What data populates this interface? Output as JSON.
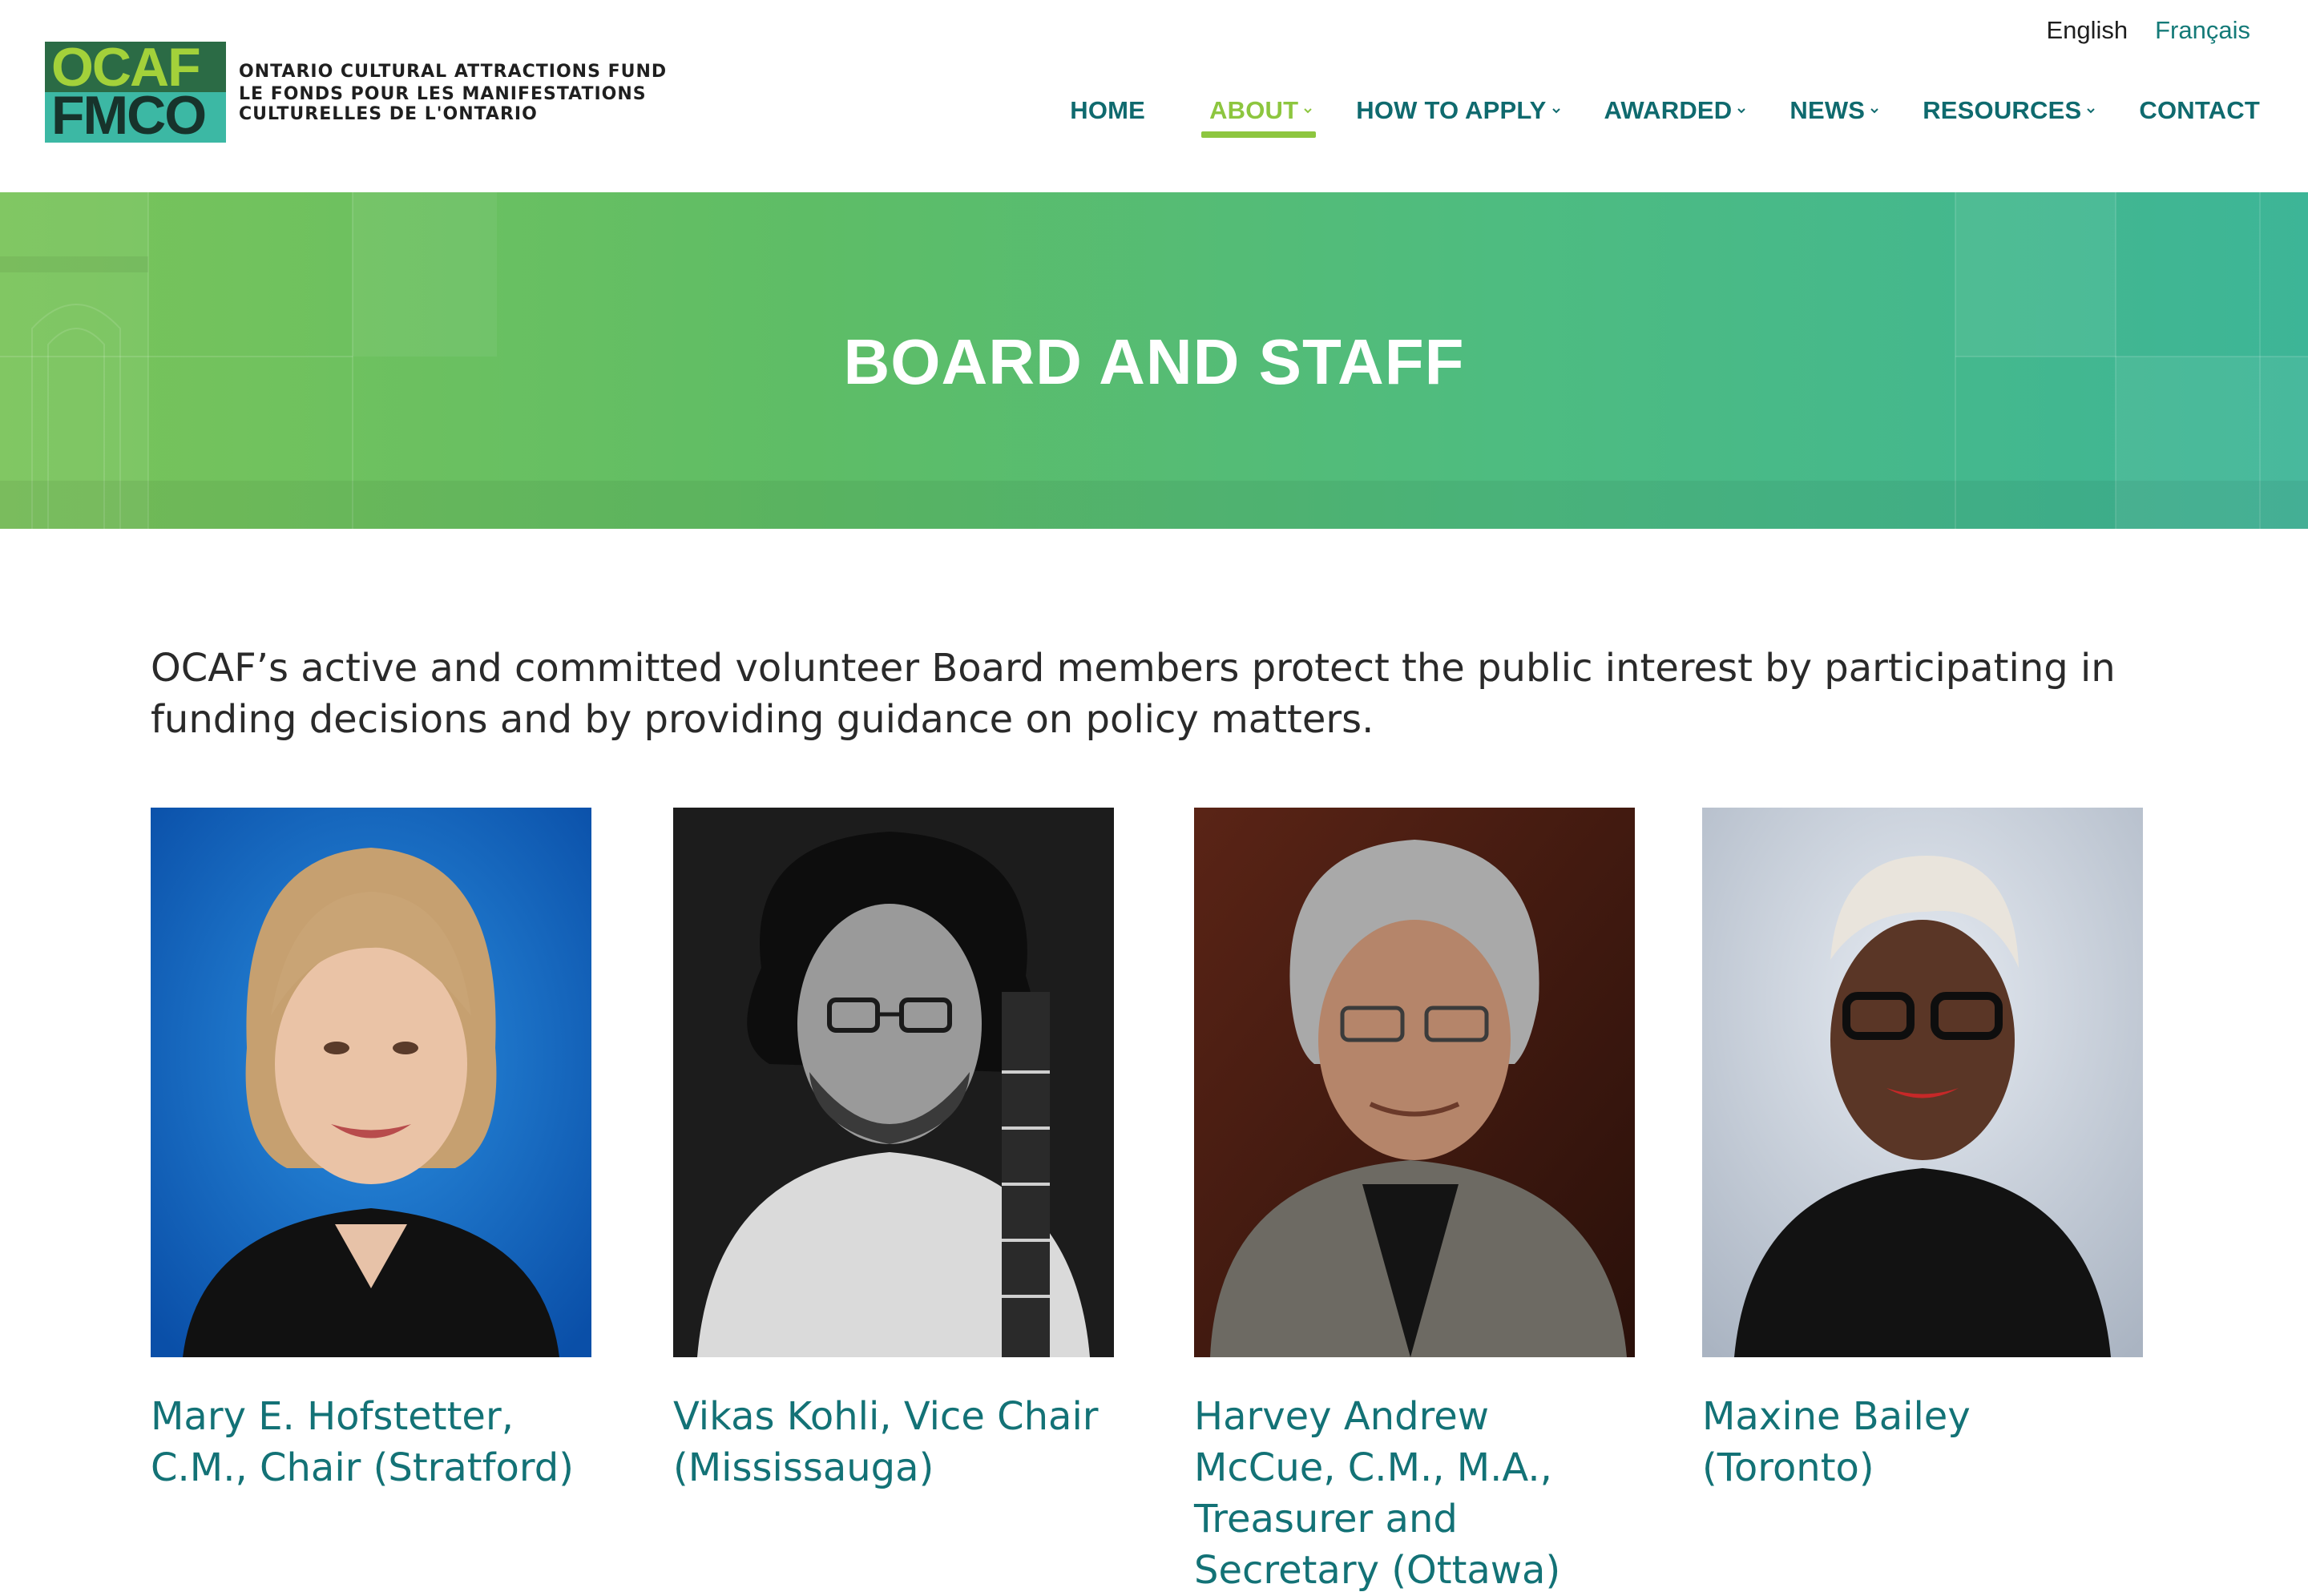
{
  "header": {
    "logo": {
      "mark_line1": "OCAF",
      "mark_line2": "FMCO",
      "text_line1": "ONTARIO CULTURAL ATTRACTIONS FUND",
      "text_line2": "LE FONDS POUR LES MANIFESTATIONS",
      "text_line3": "CULTURELLES DE L'ONTARIO"
    },
    "languages": [
      "English",
      "Français"
    ],
    "nav": [
      {
        "label": "HOME",
        "has_dropdown": false,
        "active": false
      },
      {
        "label": "ABOUT",
        "has_dropdown": true,
        "active": true
      },
      {
        "label": "HOW TO APPLY",
        "has_dropdown": true,
        "active": false
      },
      {
        "label": "AWARDED",
        "has_dropdown": true,
        "active": false
      },
      {
        "label": "NEWS",
        "has_dropdown": true,
        "active": false
      },
      {
        "label": "RESOURCES",
        "has_dropdown": true,
        "active": false
      },
      {
        "label": "CONTACT",
        "has_dropdown": false,
        "active": false
      }
    ]
  },
  "banner": {
    "title": "BOARD AND STAFF"
  },
  "intro": "OCAF’s active and committed volunteer Board members protect the public interest by participating in funding decisions and by providing guidance on policy matters.",
  "members": [
    {
      "name": "Mary E. Hofstetter, C.M., Chair (Stratford)"
    },
    {
      "name": "Vikas Kohli, Vice Chair (Mississauga)"
    },
    {
      "name": "Harvey Andrew McCue, C.M., M.A., Treasurer and Secretary (Ottawa)"
    },
    {
      "name": "Maxine Bailey (Toronto)"
    }
  ],
  "colors": {
    "nav_text": "#0f6a6e",
    "nav_active": "#8dc63f",
    "member_name": "#137276",
    "banner_start": "#7ac45a",
    "banner_end": "#3db597"
  }
}
